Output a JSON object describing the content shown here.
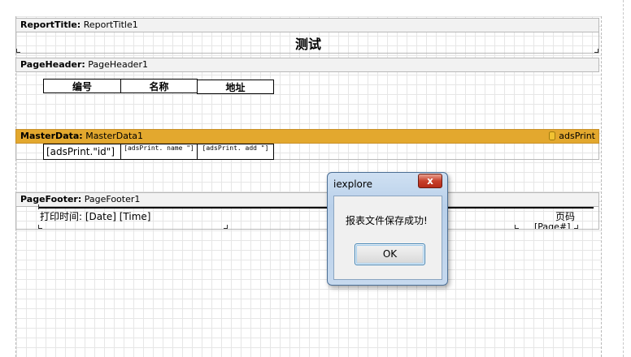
{
  "report_title_band": {
    "name": "ReportTitle:",
    "id": "ReportTitle1",
    "title": "测试"
  },
  "page_header_band": {
    "name": "PageHeader:",
    "id": "PageHeader1",
    "columns": [
      "编号",
      "名称",
      "地址"
    ]
  },
  "master_data_band": {
    "name": "MasterData:",
    "id": "MasterData1",
    "dataset": "adsPrint",
    "fields": [
      "[adsPrint.\"id\"]",
      "[adsPrint.\"name\"]",
      "[adsPrint.\"add\"]"
    ],
    "field_visible": [
      "[adsPrint.\"id\"]",
      "[adsPrint. name\n\"]",
      "[adsPrint. add\n\"]"
    ]
  },
  "page_footer_band": {
    "name": "PageFooter:",
    "id": "PageFooter1",
    "print_time": "打印时间: [Date] [Time]",
    "page_label": "页码",
    "page_value": "[Page#]"
  },
  "dialog": {
    "title": "iexplore",
    "close": "x",
    "message": "报表文件保存成功!",
    "ok_label": "OK"
  }
}
